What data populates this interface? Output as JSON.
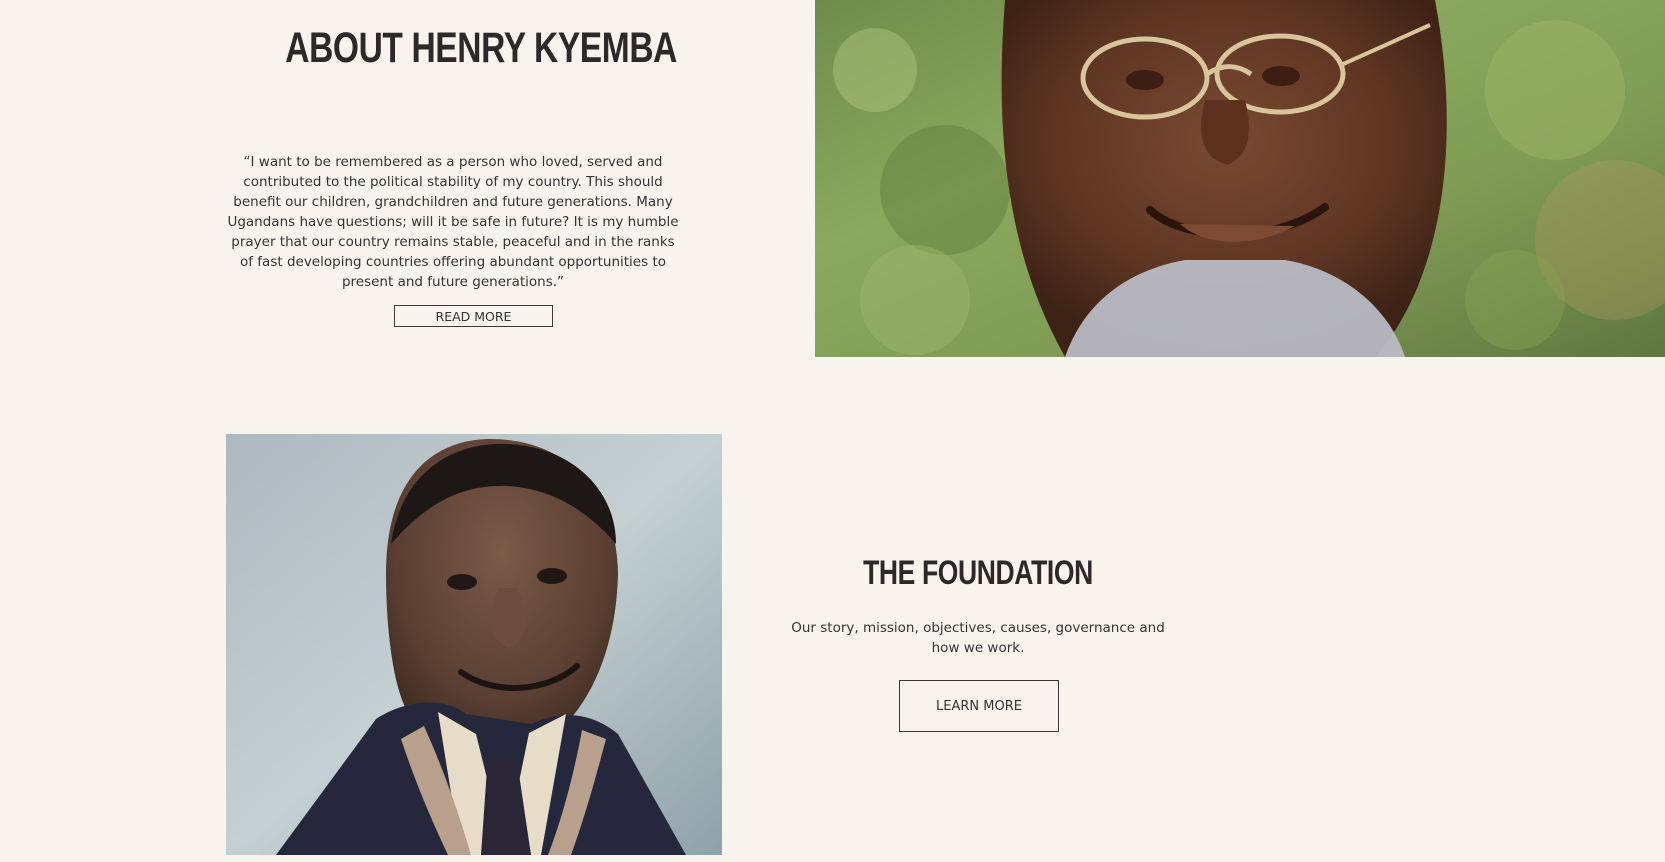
{
  "about": {
    "heading": "ABOUT HENRY KYEMBA",
    "quote": "“I want to be remembered as a person who loved, served and contributed to the political stability of my country. This should benefit our children, grandchildren and future generations. Many Ugandans have questions; will it be safe in future? It is my humble prayer that our country remains stable, peaceful and in the ranks of fast developing countries offering abundant opportunities to present and future generations.”",
    "button_label": "READ MORE"
  },
  "foundation": {
    "heading": "THE FOUNDATION",
    "description": "Our story, mission, objectives, causes, governance and how we work.",
    "button_label": "LEARN MORE"
  },
  "colors": {
    "background": "#f7f4ee",
    "text": "#2f2f2f",
    "heading": "#2b2a28",
    "button_border": "#3a3a3a"
  }
}
